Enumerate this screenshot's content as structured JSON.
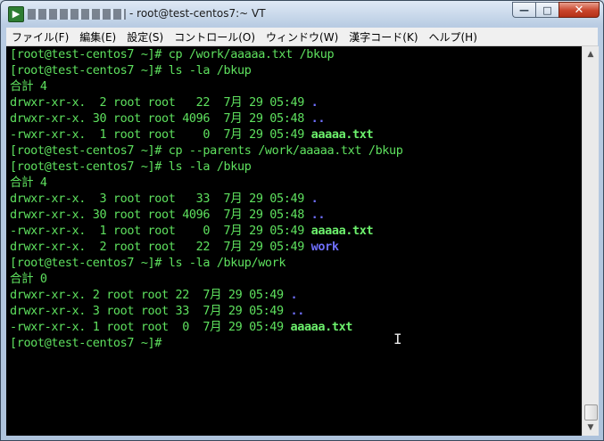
{
  "window": {
    "title": "- root@test-centos7:~ VT",
    "minimize_glyph": "—",
    "maximize_glyph": "□",
    "close_glyph": "✕"
  },
  "menu": [
    "ファイル(F)",
    "編集(E)",
    "設定(S)",
    "コントロール(O)",
    "ウィンドウ(W)",
    "漢字コード(K)",
    "ヘルプ(H)"
  ],
  "terminal": {
    "lines": [
      [
        {
          "t": "[root@test-centos7 ~]# cp /work/aaaaa.txt /bkup",
          "c": "green"
        }
      ],
      [
        {
          "t": "[root@test-centos7 ~]# ls -la /bkup",
          "c": "green"
        }
      ],
      [
        {
          "t": "合計 4",
          "c": "green"
        }
      ],
      [
        {
          "t": "drwxr-xr-x.  2 root root   22  7月 29 05:49 ",
          "c": "green"
        },
        {
          "t": ".",
          "c": "dir"
        }
      ],
      [
        {
          "t": "drwxr-xr-x. 30 root root 4096  7月 29 05:48 ",
          "c": "green"
        },
        {
          "t": "..",
          "c": "dir"
        }
      ],
      [
        {
          "t": "-rwxr-xr-x.  1 root root    0  7月 29 05:49 ",
          "c": "green"
        },
        {
          "t": "aaaaa.txt",
          "c": "file"
        }
      ],
      [
        {
          "t": "[root@test-centos7 ~]# cp --parents /work/aaaaa.txt /bkup",
          "c": "green"
        }
      ],
      [
        {
          "t": "[root@test-centos7 ~]# ls -la /bkup",
          "c": "green"
        }
      ],
      [
        {
          "t": "合計 4",
          "c": "green"
        }
      ],
      [
        {
          "t": "drwxr-xr-x.  3 root root   33  7月 29 05:49 ",
          "c": "green"
        },
        {
          "t": ".",
          "c": "dir"
        }
      ],
      [
        {
          "t": "drwxr-xr-x. 30 root root 4096  7月 29 05:48 ",
          "c": "green"
        },
        {
          "t": "..",
          "c": "dir"
        }
      ],
      [
        {
          "t": "-rwxr-xr-x.  1 root root    0  7月 29 05:49 ",
          "c": "green"
        },
        {
          "t": "aaaaa.txt",
          "c": "file"
        }
      ],
      [
        {
          "t": "drwxr-xr-x.  2 root root   22  7月 29 05:49 ",
          "c": "green"
        },
        {
          "t": "work",
          "c": "dir"
        }
      ],
      [
        {
          "t": "[root@test-centos7 ~]# ls -la /bkup/work",
          "c": "green"
        }
      ],
      [
        {
          "t": "合計 0",
          "c": "green"
        }
      ],
      [
        {
          "t": "drwxr-xr-x. 2 root root 22  7月 29 05:49 ",
          "c": "green"
        },
        {
          "t": ".",
          "c": "dir"
        }
      ],
      [
        {
          "t": "drwxr-xr-x. 3 root root 33  7月 29 05:49 ",
          "c": "green"
        },
        {
          "t": "..",
          "c": "dir"
        }
      ],
      [
        {
          "t": "-rwxr-xr-x. 1 root root  0  7月 29 05:49 ",
          "c": "green"
        },
        {
          "t": "aaaaa.txt",
          "c": "file"
        }
      ],
      [
        {
          "t": "[root@test-centos7 ~]#",
          "c": "green"
        }
      ]
    ]
  },
  "mouse_cursor_glyph": "I",
  "icons": {
    "app": "tera-term-icon",
    "scroll_up": "▲",
    "scroll_down": "▼"
  },
  "colors": {
    "prompt_text": "#5ee05e",
    "file_highlight": "#6cf06c",
    "directory": "#6f6fff",
    "terminal_bg": "#000000"
  }
}
